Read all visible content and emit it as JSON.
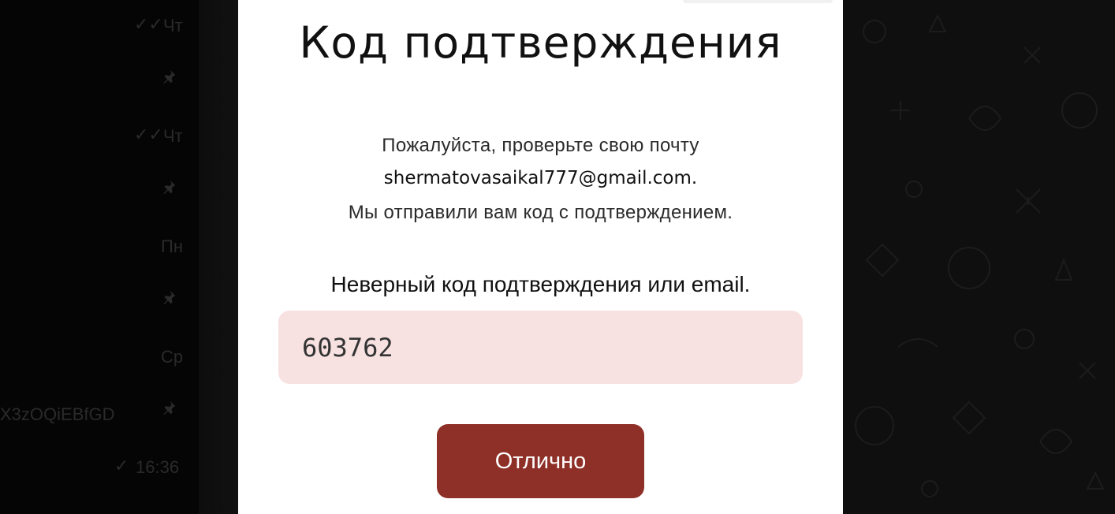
{
  "background_chat_list": {
    "items": [
      {
        "day": "Чт",
        "status": "read",
        "pinned": true
      },
      {
        "day": "Чт",
        "status": "read",
        "pinned": true
      },
      {
        "day": "Пн",
        "status": "",
        "pinned": true
      },
      {
        "day": "Ср",
        "status": "",
        "pinned": true
      },
      {
        "day": "16:36",
        "status": "sent",
        "pinned": false,
        "preview": "X3zOQiEBfGD"
      }
    ]
  },
  "modal": {
    "title": "Код подтверждения",
    "instruction_line1": "Пожалуйста, проверьте свою почту",
    "email": "shermatovasaikal777@gmail.com.",
    "instruction_line3": "Мы отправили вам код с подтверждением.",
    "error_message": "Неверный код подтверждения или email.",
    "code_value": "603762",
    "confirm_button": "Отлично"
  },
  "colors": {
    "button": "#8e3028",
    "input_background": "#f7e2e1",
    "modal_background": "#ffffff",
    "overlay": "#0b0b0b"
  },
  "icons": {
    "read": "double-check-icon",
    "sent": "check-icon",
    "pin": "pin-icon"
  }
}
